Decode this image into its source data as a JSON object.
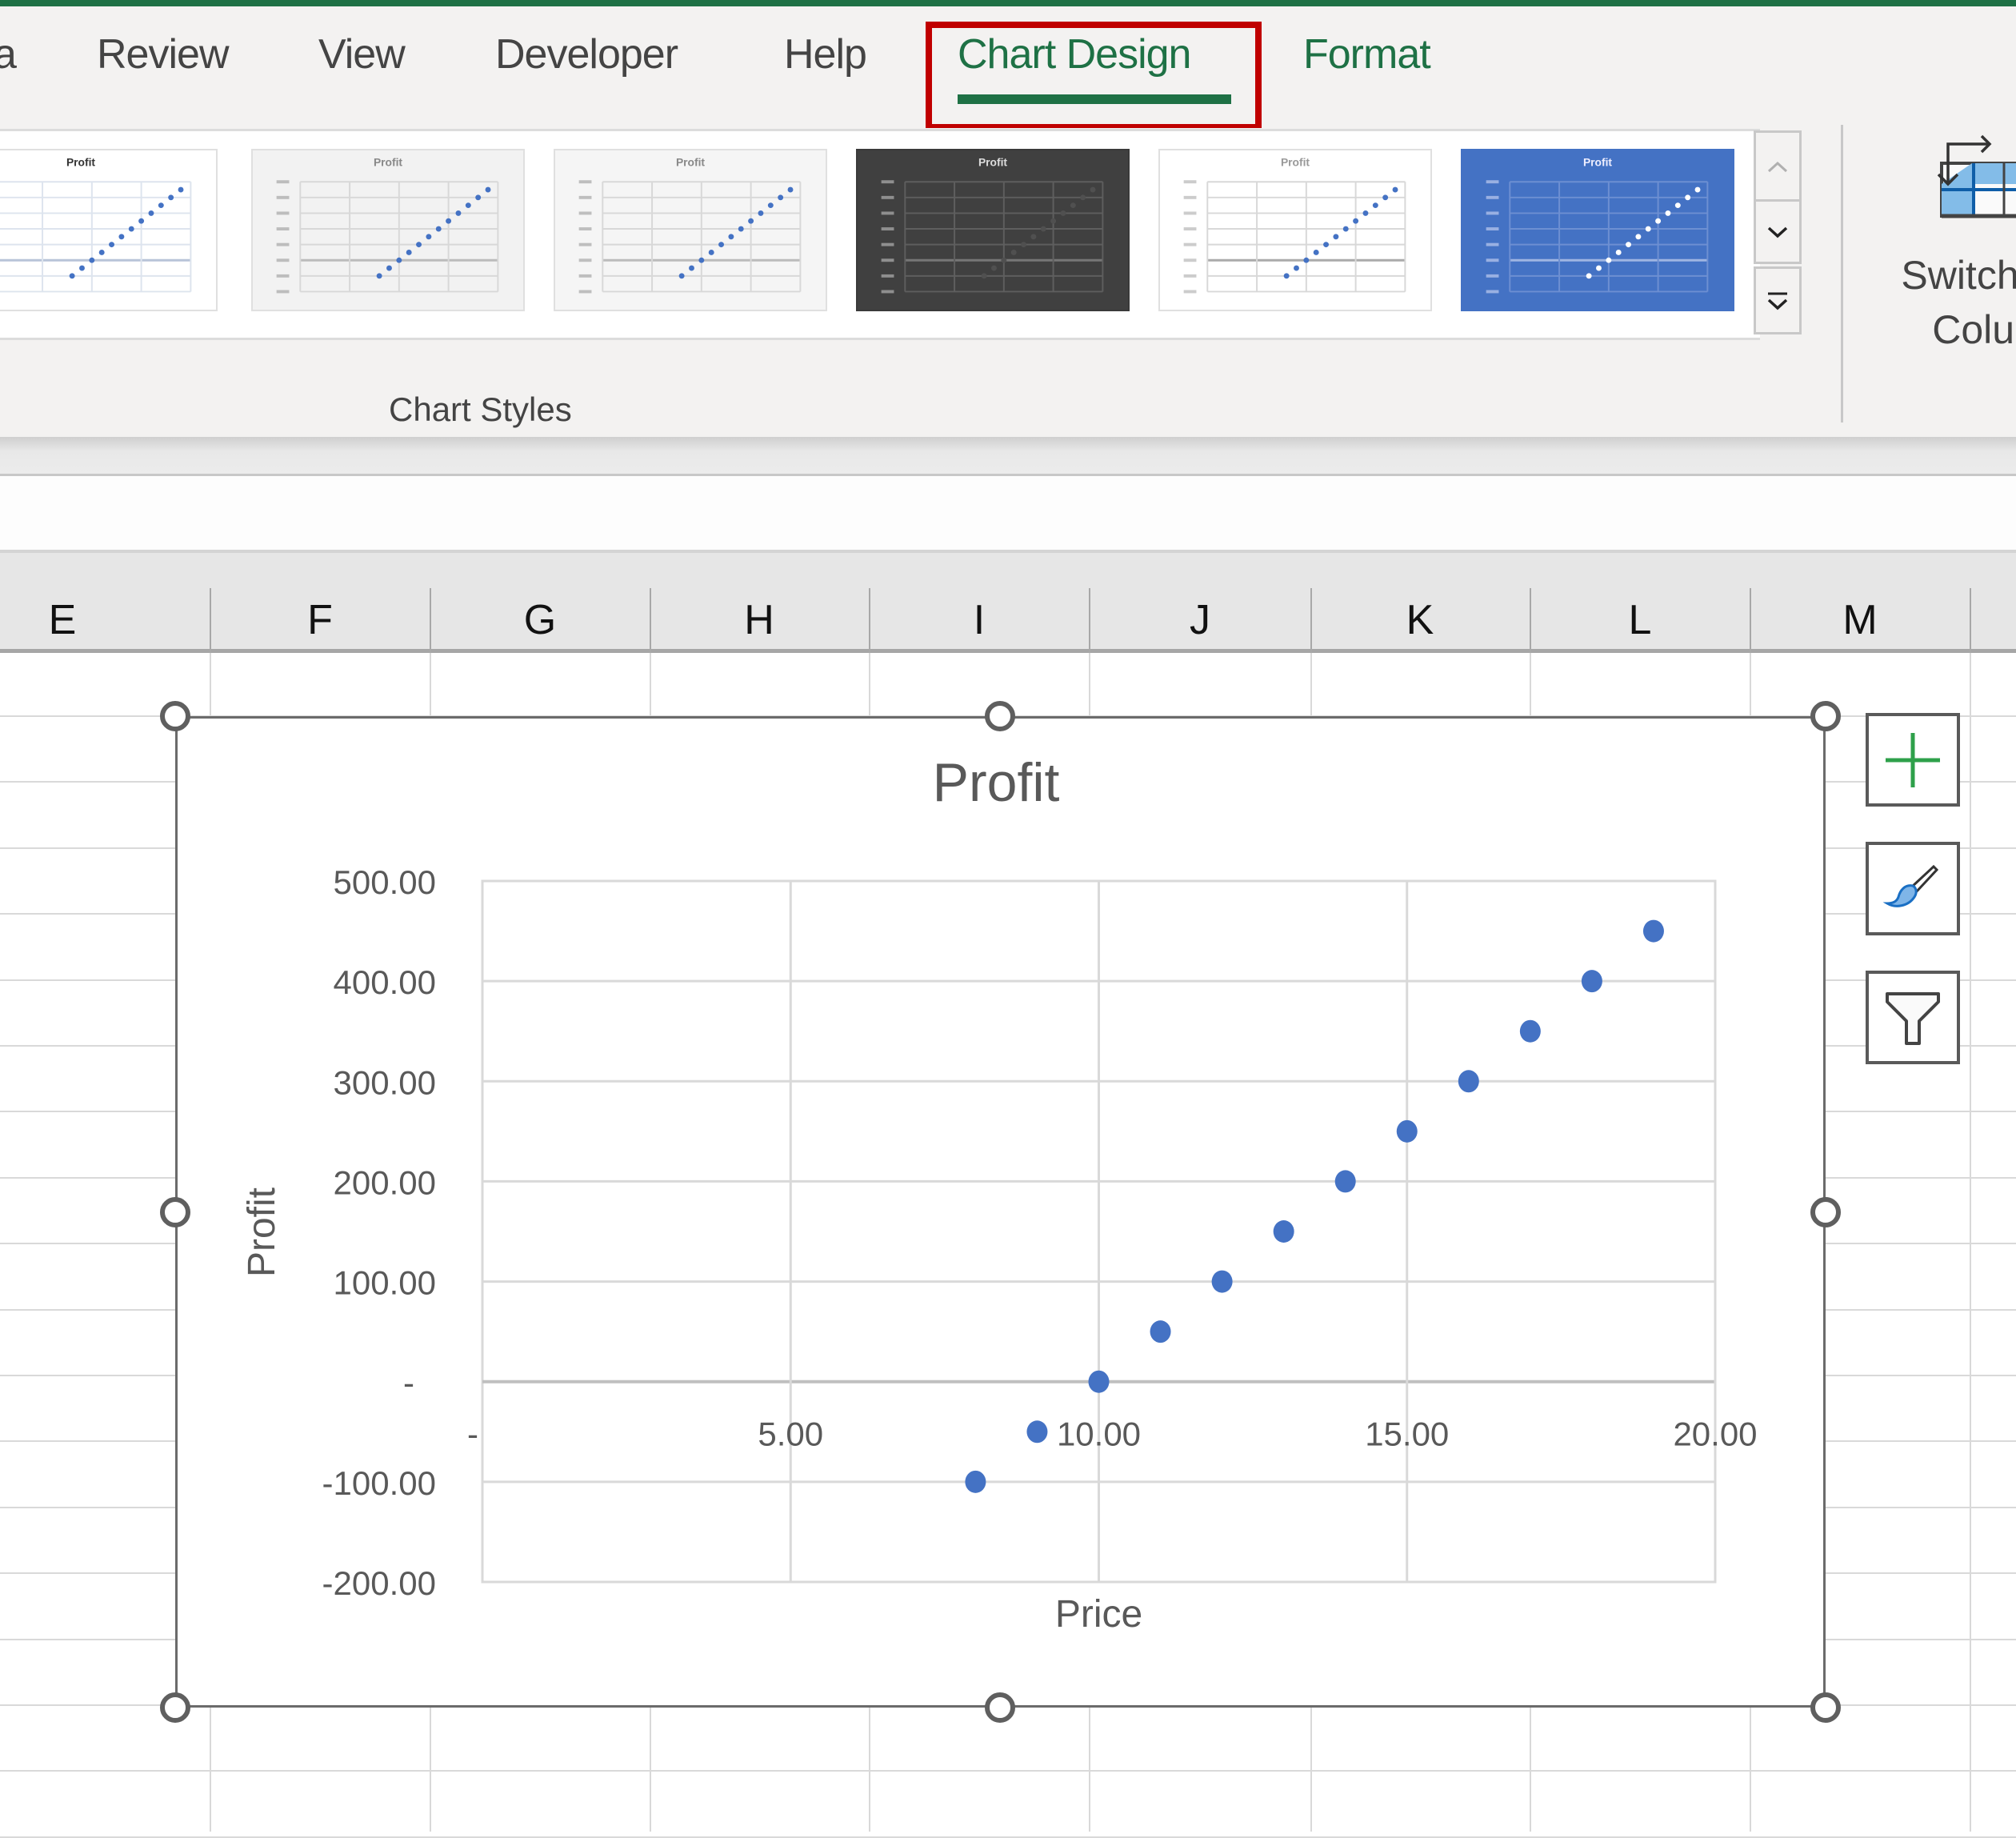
{
  "ribbon": {
    "tabs": [
      {
        "label": "a",
        "active": false
      },
      {
        "label": "Review",
        "active": false
      },
      {
        "label": "View",
        "active": false
      },
      {
        "label": "Developer",
        "active": false
      },
      {
        "label": "Help",
        "active": false
      },
      {
        "label": "Chart Design",
        "active": true,
        "highlighted": true
      },
      {
        "label": "Format",
        "active": false
      }
    ],
    "accent_color": "#1e7145",
    "highlight_color": "#c00000",
    "chart_styles_group_label": "Chart Styles",
    "chart_styles": [
      {
        "name": "Style (partial)",
        "theme": "light-blue-grid",
        "selected": false
      },
      {
        "name": "Style 2",
        "theme": "light-gray",
        "selected": false
      },
      {
        "name": "Style 3",
        "theme": "light-gradient",
        "selected": false
      },
      {
        "name": "Style 4",
        "theme": "dark",
        "selected": false
      },
      {
        "name": "Style 5",
        "theme": "white",
        "selected": false
      },
      {
        "name": "Style 6",
        "theme": "blue",
        "selected": false
      }
    ],
    "gallery_scroll": {
      "up": "chevron-up-icon",
      "down": "chevron-down-icon",
      "more": "expand-gallery-icon"
    },
    "switch_row_column": {
      "line1": "Switch R",
      "line2": "Colur"
    }
  },
  "sheet": {
    "columns": [
      "E",
      "F",
      "G",
      "H",
      "I",
      "J",
      "K",
      "L",
      "M"
    ]
  },
  "chart_side_buttons": [
    {
      "name": "chart-elements-button",
      "icon": "plus-icon"
    },
    {
      "name": "chart-styles-button",
      "icon": "paintbrush-icon"
    },
    {
      "name": "chart-filters-button",
      "icon": "funnel-icon"
    }
  ],
  "chart_data": {
    "type": "scatter",
    "title": "Profit",
    "xlabel": "Price",
    "ylabel": "Profit",
    "xlim": [
      0,
      20
    ],
    "ylim": [
      -200,
      500
    ],
    "x_ticks": [
      0,
      5,
      10,
      15,
      20
    ],
    "x_tick_labels": [
      "-",
      "5.00",
      "10.00",
      "15.00",
      "20.00"
    ],
    "y_ticks": [
      500,
      400,
      300,
      200,
      100,
      0,
      -100,
      -200
    ],
    "y_tick_labels": [
      "500.00",
      "400.00",
      "300.00",
      "200.00",
      "100.00",
      "-",
      "-100.00",
      "-200.00"
    ],
    "grid": true,
    "marker_color": "#4472c4",
    "series": [
      {
        "name": "Profit",
        "x": [
          8,
          9,
          10,
          11,
          12,
          13,
          14,
          15,
          16,
          17,
          18,
          19
        ],
        "y": [
          -100,
          -50,
          0,
          50,
          100,
          150,
          200,
          250,
          300,
          350,
          400,
          450
        ]
      }
    ]
  }
}
